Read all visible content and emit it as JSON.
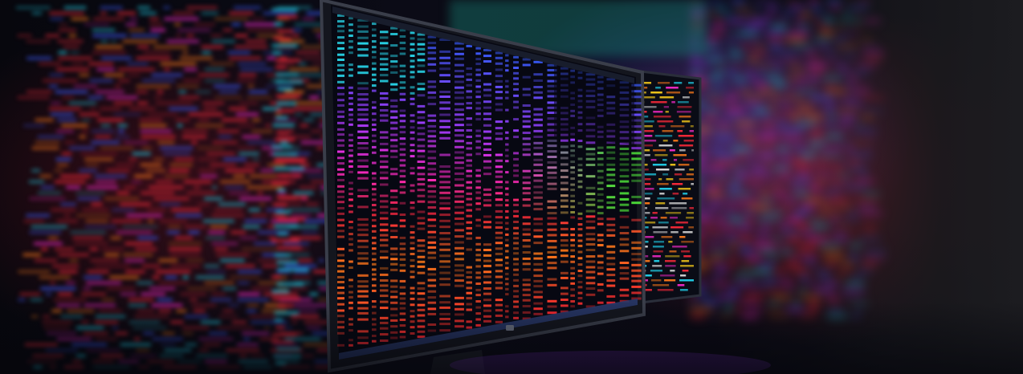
{
  "scene": {
    "description_hidden": "",
    "palette": {
      "background": "#05060c",
      "red": "#ff2a3a",
      "orange": "#ff7a1a",
      "yellow": "#ffd21a",
      "green": "#4ee03a",
      "cyan": "#22d6f0",
      "blue": "#3a5cff",
      "violet": "#a03cff",
      "magenta": "#ff2bd0",
      "bezel": "#1a1c24"
    }
  }
}
